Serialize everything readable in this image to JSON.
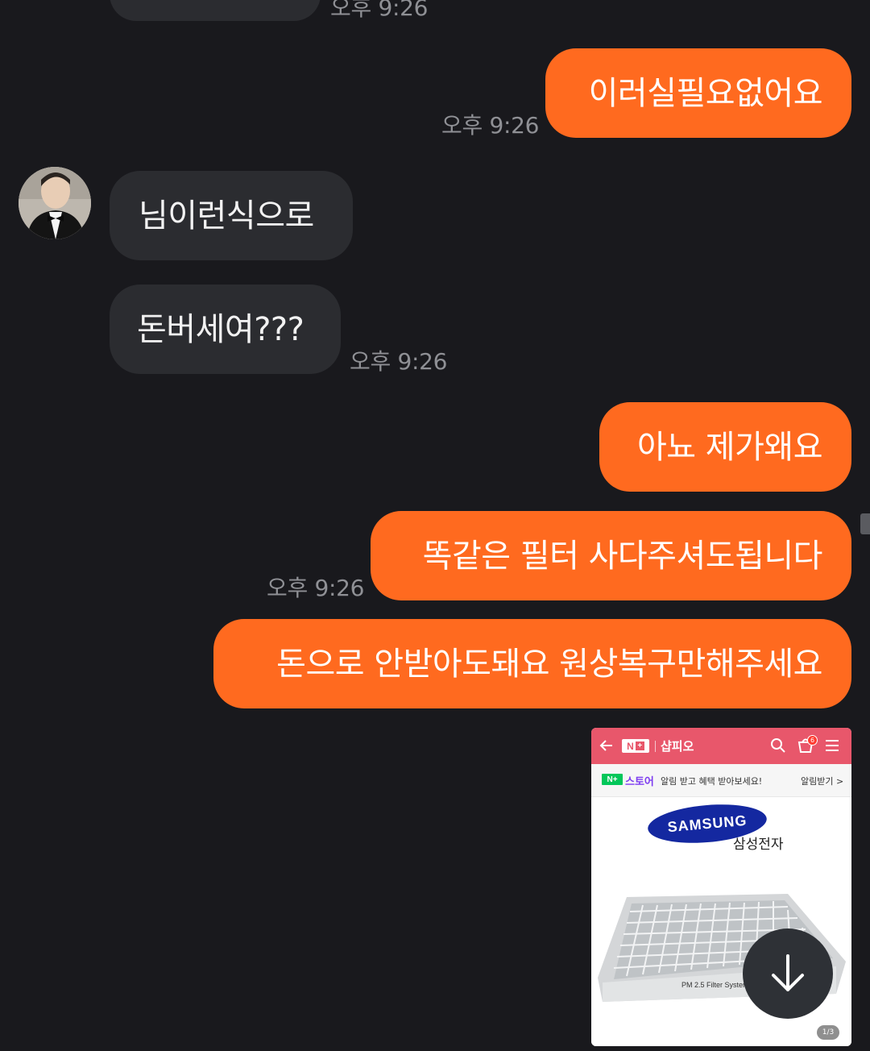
{
  "colors": {
    "background": "#19191d",
    "incoming_bubble": "#2b2c30",
    "outgoing_bubble": "#ff6a1f",
    "timestamp": "#8f9095"
  },
  "messages": [
    {
      "id": "top-cut",
      "time": "오후 9:26"
    },
    {
      "id": "m1",
      "direction": "outgoing",
      "text": "이러실필요없어요",
      "time": "오후 9:26"
    },
    {
      "id": "m2",
      "direction": "incoming",
      "text": "님이런식으로"
    },
    {
      "id": "m3",
      "direction": "incoming",
      "text": "돈버세여???",
      "time": "오후 9:26"
    },
    {
      "id": "m4",
      "direction": "outgoing",
      "text": "아뇨 제가왜요"
    },
    {
      "id": "m5",
      "direction": "outgoing",
      "text": "똑같은 필터 사다주셔도됩니다",
      "time": "오후 9:26"
    },
    {
      "id": "m6",
      "direction": "outgoing",
      "text": "돈으로 안받아도돼요 원상복구만해주세요"
    }
  ],
  "image_card": {
    "shop_name": "샵피오",
    "nplus_label": "N",
    "cart_count": "6",
    "store_label": "스토어",
    "notice_text": "알림 받고 혜택 받아보세요!",
    "notice_action": "알림받기 >",
    "brand_logo": "SAMSUNG",
    "brand_korean": "삼성전자",
    "product_caption": "PM 2.5 Filter System",
    "pager": "1/3",
    "icons": [
      "back-arrow-icon",
      "search-icon",
      "cart-icon",
      "menu-icon"
    ]
  },
  "download_icon": "download-arrow-icon"
}
